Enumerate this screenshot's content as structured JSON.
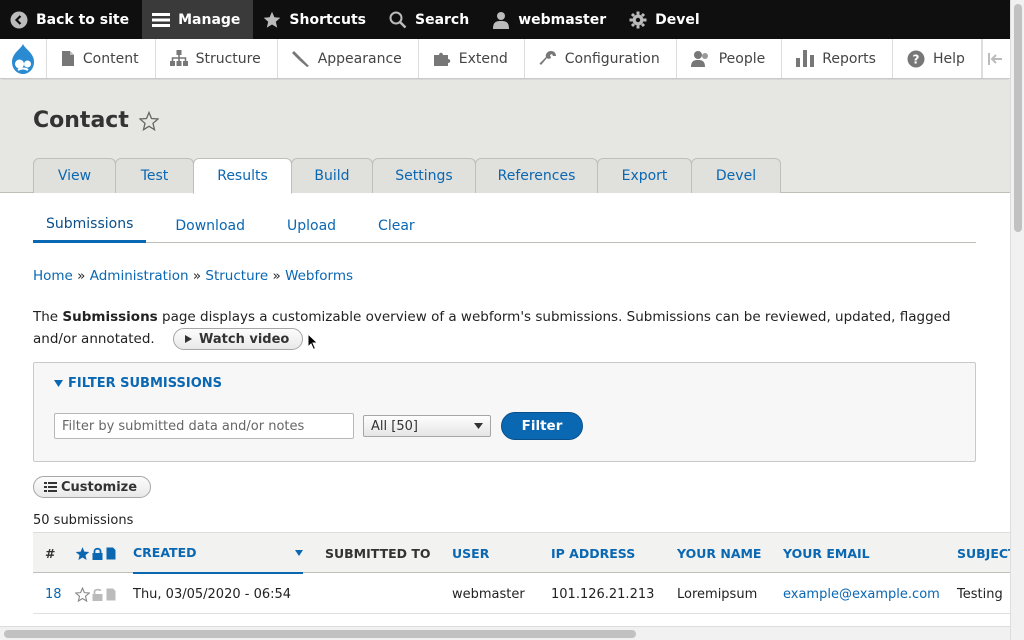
{
  "toolbar": {
    "back_to_site": "Back to site",
    "manage": "Manage",
    "shortcuts": "Shortcuts",
    "search": "Search",
    "user": "webmaster",
    "devel": "Devel"
  },
  "tray": {
    "items": [
      "Content",
      "Structure",
      "Appearance",
      "Extend",
      "Configuration",
      "People",
      "Reports",
      "Help"
    ]
  },
  "page": {
    "title": "Contact"
  },
  "tabs": [
    "View",
    "Test",
    "Results",
    "Build",
    "Settings",
    "References",
    "Export",
    "Devel"
  ],
  "active_tab": "Results",
  "subtabs": [
    "Submissions",
    "Download",
    "Upload",
    "Clear"
  ],
  "active_subtab": "Submissions",
  "breadcrumb": {
    "home": "Home",
    "administration": "Administration",
    "structure": "Structure",
    "webforms": "Webforms",
    "sep": "»"
  },
  "description": {
    "before": "The ",
    "bold": "Submissions",
    "after": " page displays a customizable overview of a webform's submissions. Submissions can be reviewed, updated, flagged and/or annotated.",
    "watch_video": "Watch video"
  },
  "filter": {
    "legend": "FILTER SUBMISSIONS",
    "placeholder": "Filter by submitted data and/or notes",
    "select_value": "All [50]",
    "button": "Filter"
  },
  "customize": "Customize",
  "count": "50 submissions",
  "table": {
    "headers": {
      "num": "#",
      "created": "CREATED",
      "submitted_to": "SUBMITTED TO",
      "user": "USER",
      "ip": "IP ADDRESS",
      "name": "YOUR NAME",
      "email": "YOUR EMAIL",
      "subject": "SUBJECT"
    },
    "rows": [
      {
        "num": "18",
        "created": "Thu, 03/05/2020 - 06:54",
        "submitted_to": "",
        "user": "webmaster",
        "ip": "101.126.21.213",
        "name": "Loremipsum",
        "email": "example@example.com",
        "subject": "Testing"
      }
    ]
  },
  "colors": {
    "accent": "#0a67b2",
    "toolbar_bg": "#0f0f0f",
    "header_bg": "#e6e6e2"
  }
}
